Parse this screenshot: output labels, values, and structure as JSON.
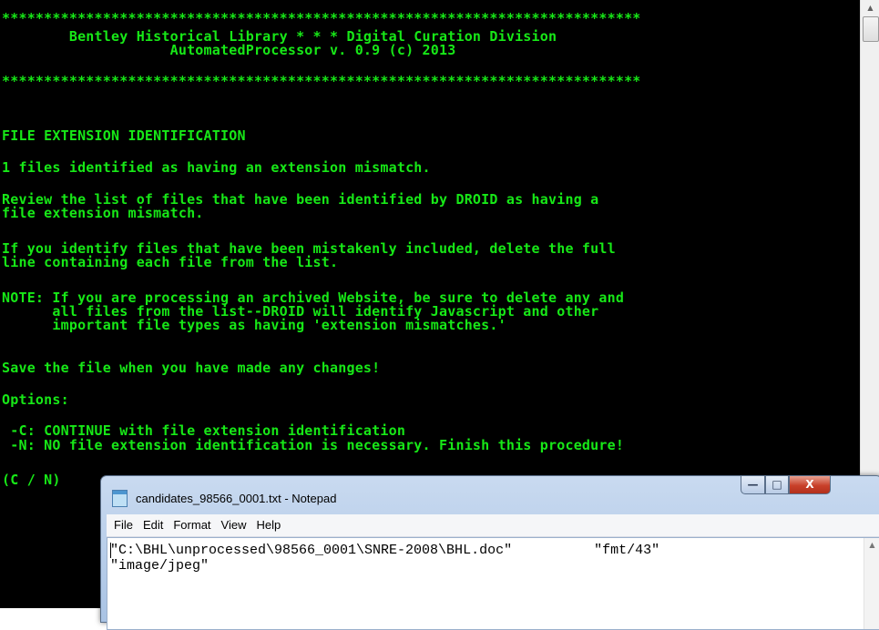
{
  "console": {
    "lines": [
      "****************************************************************************",
      "        Bentley Historical Library * * * Digital Curation Division",
      "                    AutomatedProcessor v. 0.9 (c) 2013",
      "****************************************************************************",
      "FILE EXTENSION IDENTIFICATION",
      "1 files identified as having an extension mismatch.",
      "Review the list of files that have been identified by DROID as having a",
      "file extension mismatch.",
      "If you identify files that have been mistakenly included, delete the full",
      "line containing each file from the list.",
      "NOTE: If you are processing an archived Website, be sure to delete any and",
      "      all files from the list--DROID will identify Javascript and other",
      "      important file types as having 'extension mismatches.'",
      "Save the file when you have made any changes!",
      "Options:",
      " -C: CONTINUE with file extension identification",
      " -N: NO file extension identification is necessary. Finish this procedure!",
      "(C / N)"
    ]
  },
  "notepad": {
    "title": "candidates_98566_0001.txt - Notepad",
    "menu": [
      "File",
      "Edit",
      "Format",
      "View",
      "Help"
    ],
    "content_lines": [
      "\"C:\\BHL\\unprocessed\\98566_0001\\SNRE-2008\\BHL.doc\"          \"fmt/43\"",
      "\"image/jpeg\""
    ],
    "buttons": {
      "minimize": "—",
      "maximize": "□",
      "close": "X"
    }
  },
  "colors": {
    "console_text": "#17e817",
    "console_bg": "#000000"
  }
}
